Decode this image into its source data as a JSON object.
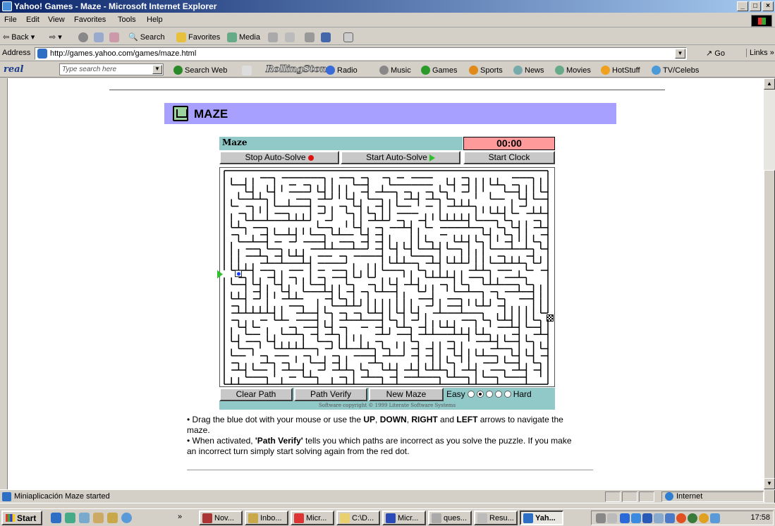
{
  "window": {
    "title": "Yahoo! Games - Maze - Microsoft Internet Explorer"
  },
  "menu": [
    "File",
    "Edit",
    "View",
    "Favorites",
    "Tools",
    "Help"
  ],
  "toolbar": {
    "back": "Back",
    "search": "Search",
    "favorites": "Favorites",
    "media": "Media"
  },
  "address": {
    "label": "Address",
    "url": "http://games.yahoo.com/games/maze.html",
    "go": "Go",
    "links": "Links"
  },
  "realbar": {
    "logo": "real",
    "search_placeholder": "Type search here",
    "search_web": "Search Web",
    "rolling_stone": "RollingStone",
    "items": [
      "Radio",
      "Music",
      "Games",
      "Sports",
      "News",
      "Movies",
      "HotStuff",
      "TV/Celebs"
    ]
  },
  "page": {
    "heading": "MAZE",
    "maze_title": "Maze",
    "timer": "00:00",
    "stop_autosolve": "Stop Auto-Solve",
    "start_autosolve": "Start Auto-Solve",
    "start_clock": "Start Clock",
    "clear_path": "Clear Path",
    "path_verify": "Path Verify",
    "new_maze": "New Maze",
    "easy": "Easy",
    "hard": "Hard",
    "difficulty_selected": 2,
    "copyright": "Software copyright © 1999 Literate Software Systems",
    "instr1_a": "• Drag the blue dot with your mouse or use the ",
    "instr1_up": "UP",
    "instr1_down": "DOWN",
    "instr1_right": "RIGHT",
    "instr1_and": " and ",
    "instr1_left": "LEFT",
    "instr1_b": " arrows to navigate the maze.",
    "instr2_a": "• When activated, ",
    "instr2_pv": "'Path Verify'",
    "instr2_b": " tells you which paths are incorrect as you solve the puzzle. If you make an incorrect turn simply start solving again from the red dot."
  },
  "status": {
    "text": "Miniaplicación Maze started",
    "zone": "Internet"
  },
  "taskbar": {
    "start": "Start",
    "tasks": [
      "Nov...",
      "Inbo...",
      "Micr...",
      "C:\\D...",
      "Micr...",
      "ques...",
      "Resu...",
      "Yah..."
    ],
    "time": "17:58"
  },
  "colors": {
    "heading_band": "#a7a0ff",
    "maze_bar": "#91c8c8",
    "timer_bg": "#ff9a9a"
  }
}
